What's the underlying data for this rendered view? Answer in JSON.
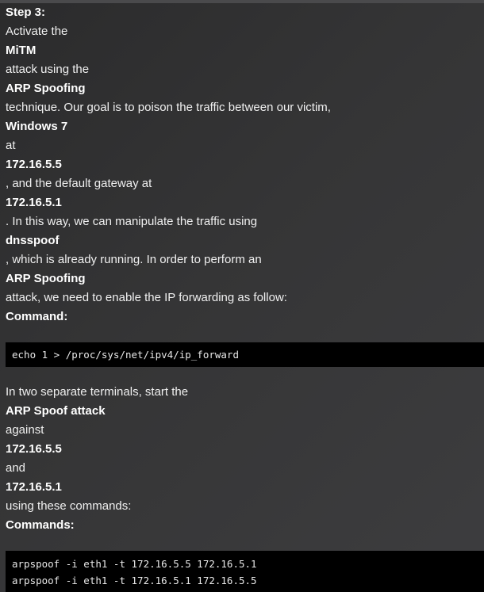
{
  "section1": {
    "lines": [
      {
        "text": "Step 3:",
        "bold": true
      },
      {
        "text": "Activate the",
        "bold": false
      },
      {
        "text": "MiTM",
        "bold": true
      },
      {
        "text": "attack using the",
        "bold": false
      },
      {
        "text": "ARP Spoofing",
        "bold": true
      },
      {
        "text": "technique. Our goal is to poison the traffic between our victim,",
        "bold": false
      },
      {
        "text": "Windows 7",
        "bold": true
      },
      {
        "text": "at",
        "bold": false
      },
      {
        "text": "172.16.5.5",
        "bold": true
      },
      {
        "text": ", and the default gateway at",
        "bold": false
      },
      {
        "text": "172.16.5.1",
        "bold": true
      },
      {
        "text": ". In this way, we can manipulate the traffic using",
        "bold": false
      },
      {
        "text": "dnsspoof",
        "bold": true
      },
      {
        "text": ", which is already running. In order to perform an",
        "bold": false
      },
      {
        "text": "ARP Spoofing",
        "bold": true
      },
      {
        "text": "attack, we need to enable the IP forwarding as follow:",
        "bold": false
      },
      {
        "text": "Command:",
        "bold": true
      }
    ],
    "code": [
      "echo 1 > /proc/sys/net/ipv4/ip_forward"
    ]
  },
  "section2": {
    "lines": [
      {
        "text": "In two separate terminals, start the",
        "bold": false
      },
      {
        "text": "ARP Spoof attack",
        "bold": true
      },
      {
        "text": "against",
        "bold": false
      },
      {
        "text": "172.16.5.5",
        "bold": true
      },
      {
        "text": "and",
        "bold": false
      },
      {
        "text": "172.16.5.1",
        "bold": true
      },
      {
        "text": "using these commands:",
        "bold": false
      },
      {
        "text": "Commands:",
        "bold": true
      }
    ],
    "code": [
      "arpspoof -i eth1 -t 172.16.5.5 172.16.5.1",
      "arpspoof -i eth1 -t 172.16.5.1 172.16.5.5"
    ]
  }
}
